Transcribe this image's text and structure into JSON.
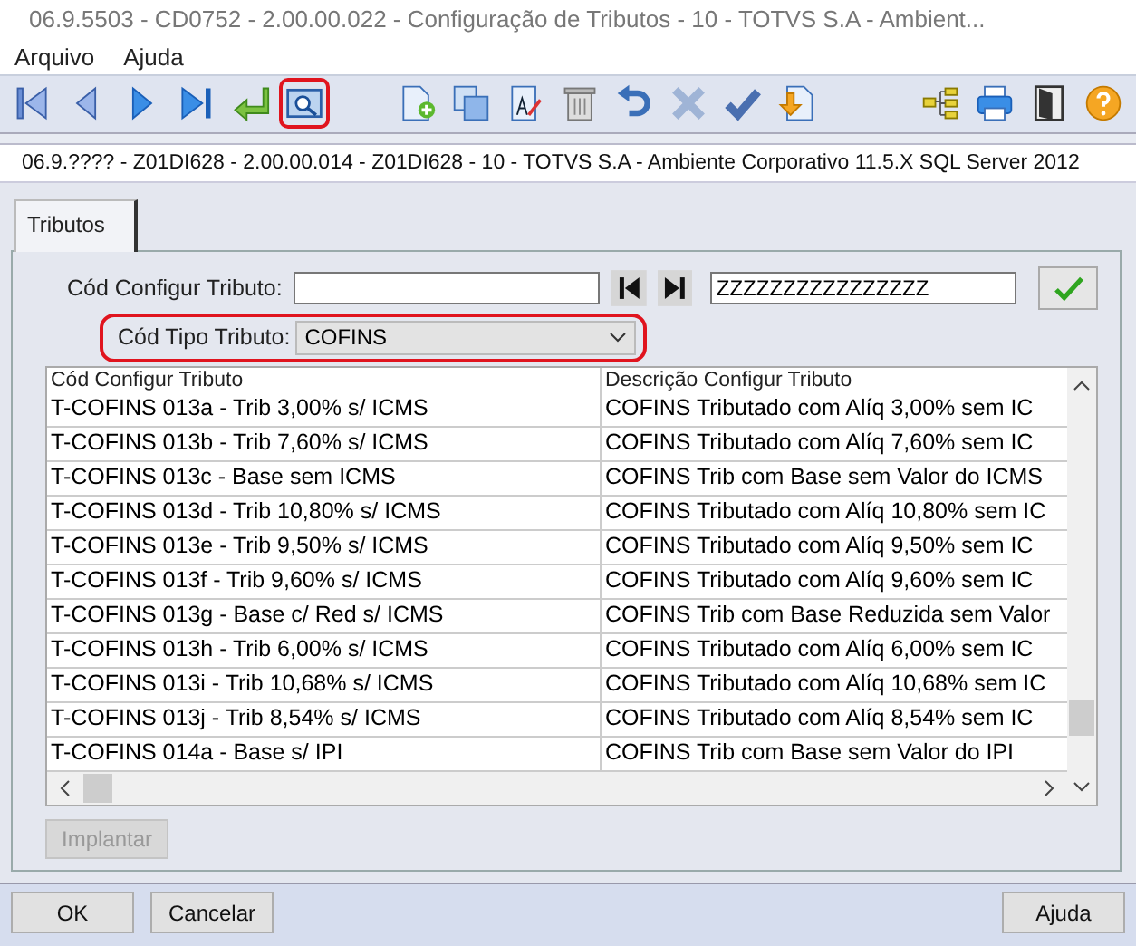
{
  "window": {
    "title": "06.9.5503 - CD0752 - 2.00.00.022 - Configuração de Tributos - 10 - TOTVS S.A - Ambient..."
  },
  "menu": [
    "Arquivo",
    "Ajuda"
  ],
  "toolbar": [
    {
      "kind": "first",
      "highlighted": false
    },
    {
      "kind": "prev",
      "highlighted": false
    },
    {
      "kind": "next",
      "highlighted": false
    },
    {
      "kind": "last",
      "highlighted": false
    },
    {
      "kind": "return",
      "highlighted": false
    },
    {
      "kind": "search",
      "highlighted": true
    },
    {
      "kind": "gap"
    },
    {
      "kind": "new",
      "highlighted": false
    },
    {
      "kind": "copy",
      "highlighted": false
    },
    {
      "kind": "edit",
      "highlighted": false
    },
    {
      "kind": "delete",
      "highlighted": false
    },
    {
      "kind": "undo",
      "highlighted": false
    },
    {
      "kind": "cancel",
      "highlighted": false
    },
    {
      "kind": "confirm",
      "highlighted": false
    },
    {
      "kind": "import",
      "highlighted": false
    },
    {
      "kind": "gap"
    },
    {
      "kind": "tree",
      "highlighted": false
    },
    {
      "kind": "print",
      "highlighted": false
    },
    {
      "kind": "exit",
      "highlighted": false
    },
    {
      "kind": "help",
      "highlighted": false
    }
  ],
  "dialog": {
    "title": "06.9.???? - Z01DI628 - 2.00.00.014 - Z01DI628 - 10 - TOTVS S.A - Ambiente Corporativo 11.5.X SQL Server 2012"
  },
  "tabs": [
    {
      "label": "Tributos",
      "selected": true
    }
  ],
  "filter": {
    "label": "Cód Configur Tributo:",
    "to_value": "ZZZZZZZZZZZZZZZZ"
  },
  "type_field": {
    "label": "Cód Tipo Tributo:",
    "value": "COFINS",
    "highlighted": true
  },
  "table": {
    "columns": [
      "Cód Configur Tributo",
      "Descrição Configur Tributo"
    ],
    "rows": [
      [
        "T-COFINS 013a - Trib 3,00% s/ ICMS",
        "COFINS Tributado com Alíq 3,00% sem IC"
      ],
      [
        "T-COFINS 013b - Trib 7,60% s/ ICMS",
        "COFINS Tributado com Alíq 7,60% sem IC"
      ],
      [
        "T-COFINS 013c - Base sem ICMS",
        "COFINS Trib com Base sem Valor do ICMS"
      ],
      [
        "T-COFINS 013d - Trib 10,80% s/ ICMS",
        "COFINS Tributado com Alíq 10,80% sem IC"
      ],
      [
        "T-COFINS 013e - Trib 9,50% s/ ICMS",
        "COFINS Tributado com Alíq 9,50% sem IC"
      ],
      [
        "T-COFINS 013f - Trib 9,60% s/ ICMS",
        "COFINS Tributado com Alíq 9,60% sem IC"
      ],
      [
        "T-COFINS 013g - Base c/ Red s/ ICMS",
        "COFINS Trib com Base Reduzida sem Valor"
      ],
      [
        "T-COFINS 013h - Trib 6,00% s/ ICMS",
        "COFINS Tributado com Alíq 6,00% sem IC"
      ],
      [
        "T-COFINS 013i - Trib 10,68% s/ ICMS",
        "COFINS Tributado com Alíq 10,68% sem IC"
      ],
      [
        "T-COFINS 013j - Trib 8,54% s/ ICMS",
        "COFINS Tributado com Alíq 8,54% sem IC"
      ],
      [
        "T-COFINS 014a - Base s/ IPI",
        "COFINS Trib com Base sem Valor do IPI"
      ]
    ]
  },
  "implant_button": {
    "label": "Implantar",
    "disabled": true
  },
  "buttons": [
    {
      "label": "OK",
      "kind": "left"
    },
    {
      "label": "Cancelar",
      "kind": "left"
    },
    {
      "label": "Ajuda",
      "kind": "right"
    }
  ]
}
